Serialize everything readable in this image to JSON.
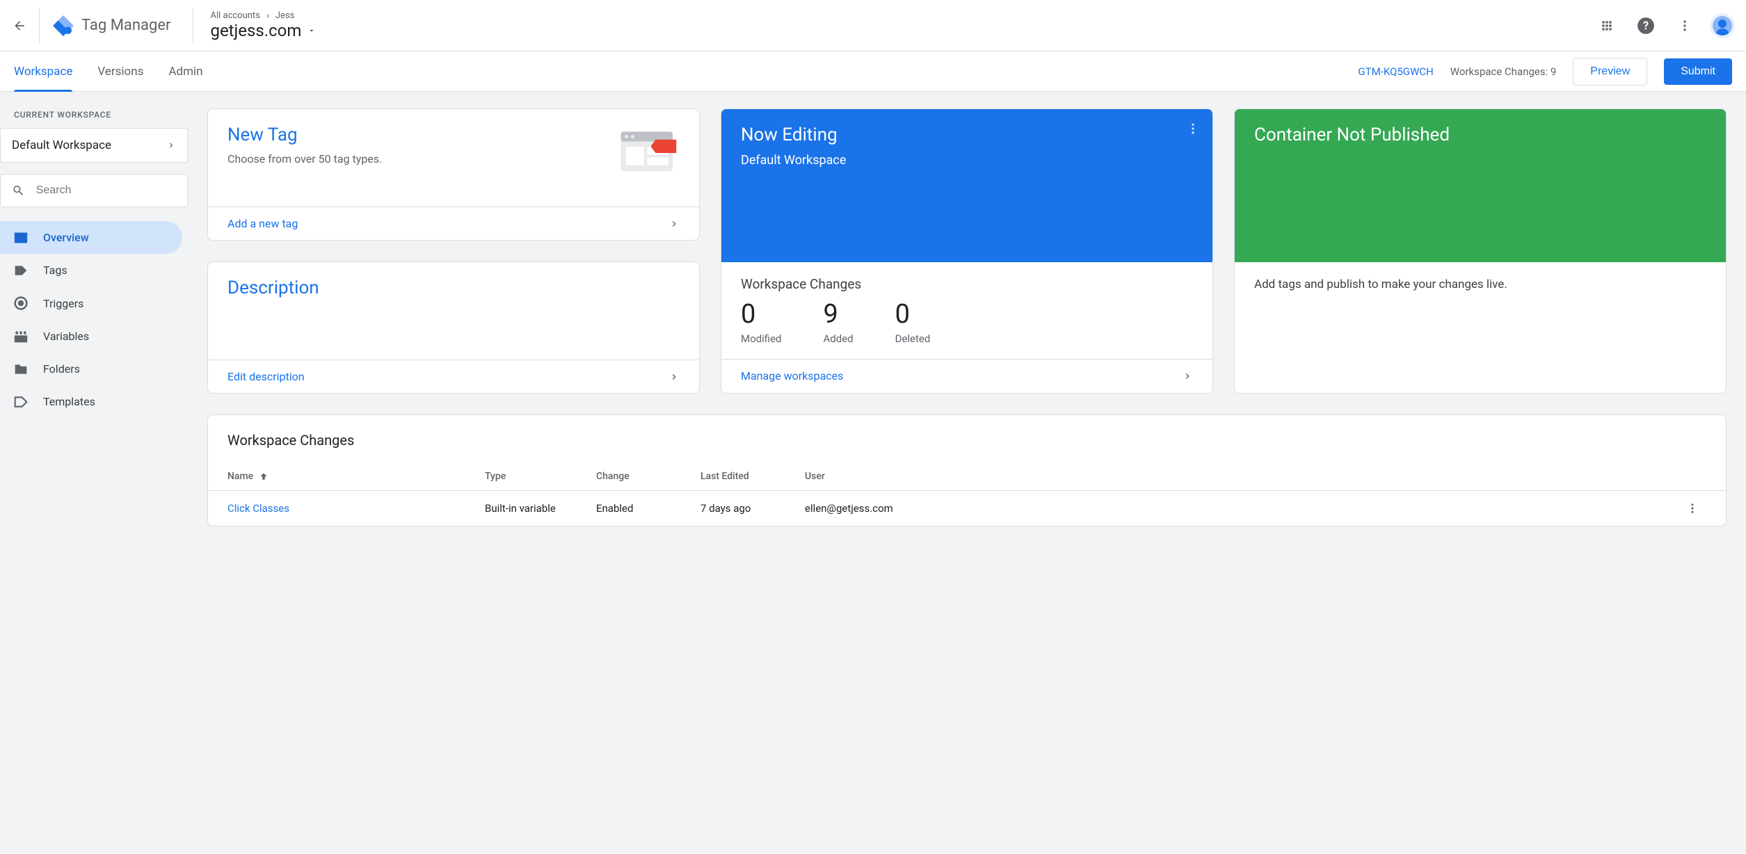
{
  "header": {
    "product_name": "Tag Manager",
    "breadcrumb_root": "All accounts",
    "breadcrumb_account": "Jess",
    "container_name": "getjess.com"
  },
  "nav": {
    "tabs": [
      "Workspace",
      "Versions",
      "Admin"
    ],
    "container_id": "GTM-KQ5GWCH",
    "changes_label": "Workspace Changes: 9",
    "preview": "Preview",
    "submit": "Submit"
  },
  "sidebar": {
    "current_label": "CURRENT WORKSPACE",
    "workspace_name": "Default Workspace",
    "search_placeholder": "Search",
    "items": [
      "Overview",
      "Tags",
      "Triggers",
      "Variables",
      "Folders",
      "Templates"
    ]
  },
  "cards": {
    "new_tag": {
      "title": "New Tag",
      "subtitle": "Choose from over 50 tag types.",
      "action": "Add a new tag"
    },
    "editing": {
      "title": "Now Editing",
      "subtitle": "Default Workspace",
      "changes_title": "Workspace Changes",
      "stats": [
        {
          "num": "0",
          "label": "Modified"
        },
        {
          "num": "9",
          "label": "Added"
        },
        {
          "num": "0",
          "label": "Deleted"
        }
      ],
      "action": "Manage workspaces"
    },
    "publish": {
      "title": "Container Not Published",
      "body": "Add tags and publish to make your changes live."
    },
    "description": {
      "title": "Description",
      "action": "Edit description"
    }
  },
  "table": {
    "title": "Workspace Changes",
    "headers": {
      "name": "Name",
      "type": "Type",
      "change": "Change",
      "edited": "Last Edited",
      "user": "User"
    },
    "rows": [
      {
        "name": "Click Classes",
        "type": "Built-in variable",
        "change": "Enabled",
        "edited": "7 days ago",
        "user": "ellen@getjess.com"
      }
    ]
  }
}
